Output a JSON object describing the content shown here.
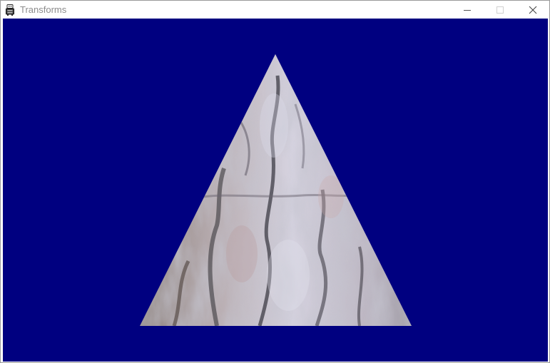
{
  "window": {
    "title": "Transforms",
    "icon": "robot-app-icon",
    "controls": {
      "minimize_icon": "minimize-icon",
      "maximize_icon": "maximize-icon",
      "close_icon": "close-icon"
    }
  },
  "scene": {
    "background_color": "#000080",
    "shape": "triangle",
    "texture": "tree-bark"
  }
}
